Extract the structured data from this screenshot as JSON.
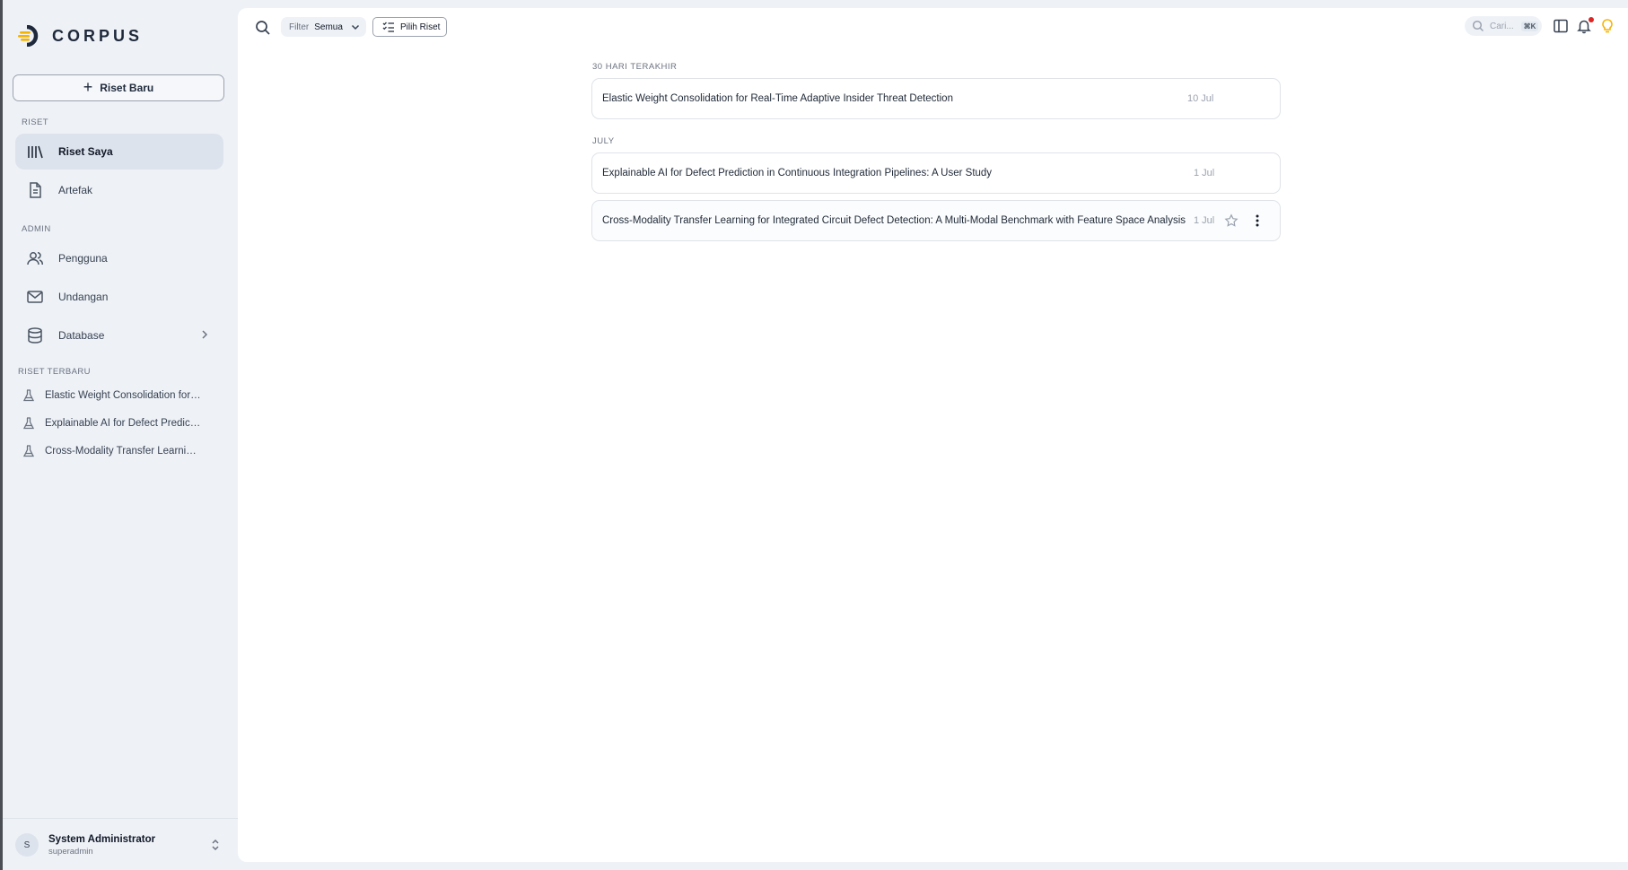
{
  "app": {
    "brand": "CORPUS"
  },
  "sidebar": {
    "new_button": "Riset Baru",
    "section_riset": "RISET",
    "section_admin": "ADMIN",
    "section_recent": "RISET TERBARU",
    "items": [
      {
        "label": "Riset Saya",
        "icon": "library-icon",
        "active": true
      },
      {
        "label": "Artefak",
        "icon": "document-icon"
      },
      {
        "label": "Pengguna",
        "icon": "users-icon"
      },
      {
        "label": "Undangan",
        "icon": "mail-icon"
      },
      {
        "label": "Database",
        "icon": "database-icon"
      }
    ],
    "recent": [
      "Elastic Weight Consolidation for Real-Time Adaptive Insider Threat Detection",
      "Explainable AI for Defect Prediction in Continuous Integration Pipelines: A User Study",
      "Cross-Modality Transfer Learning for Integrated Circuit Defect Detection: A Multi-Modal Benchmark with Feature Space Analysis"
    ],
    "user": {
      "initial": "S",
      "name": "System Administrator",
      "username": "superadmin"
    }
  },
  "toolbar": {
    "filter_label": "Filter",
    "filter_value": "Semua",
    "pick_label": "Pilih Riset",
    "search_placeholder": "Cari...",
    "shortcut": "⌘K"
  },
  "groups": [
    {
      "label": "30 HARI TERAKHIR",
      "items": [
        {
          "title": "Elastic Weight Consolidation for Real-Time Adaptive Insider Threat Detection",
          "date": "10 Jul"
        }
      ]
    },
    {
      "label": "JULY",
      "items": [
        {
          "title": "Explainable AI for Defect Prediction in Continuous Integration Pipelines: A User Study",
          "date": "1 Jul"
        },
        {
          "title": "Cross-Modality Transfer Learning for Integrated Circuit Defect Detection: A Multi-Modal Benchmark with Feature Space Analysis",
          "date": "1 Jul"
        }
      ]
    }
  ],
  "colors": {
    "accent": "#f5b301",
    "brand_dark": "#1e293b",
    "notification": "#dc2626"
  }
}
